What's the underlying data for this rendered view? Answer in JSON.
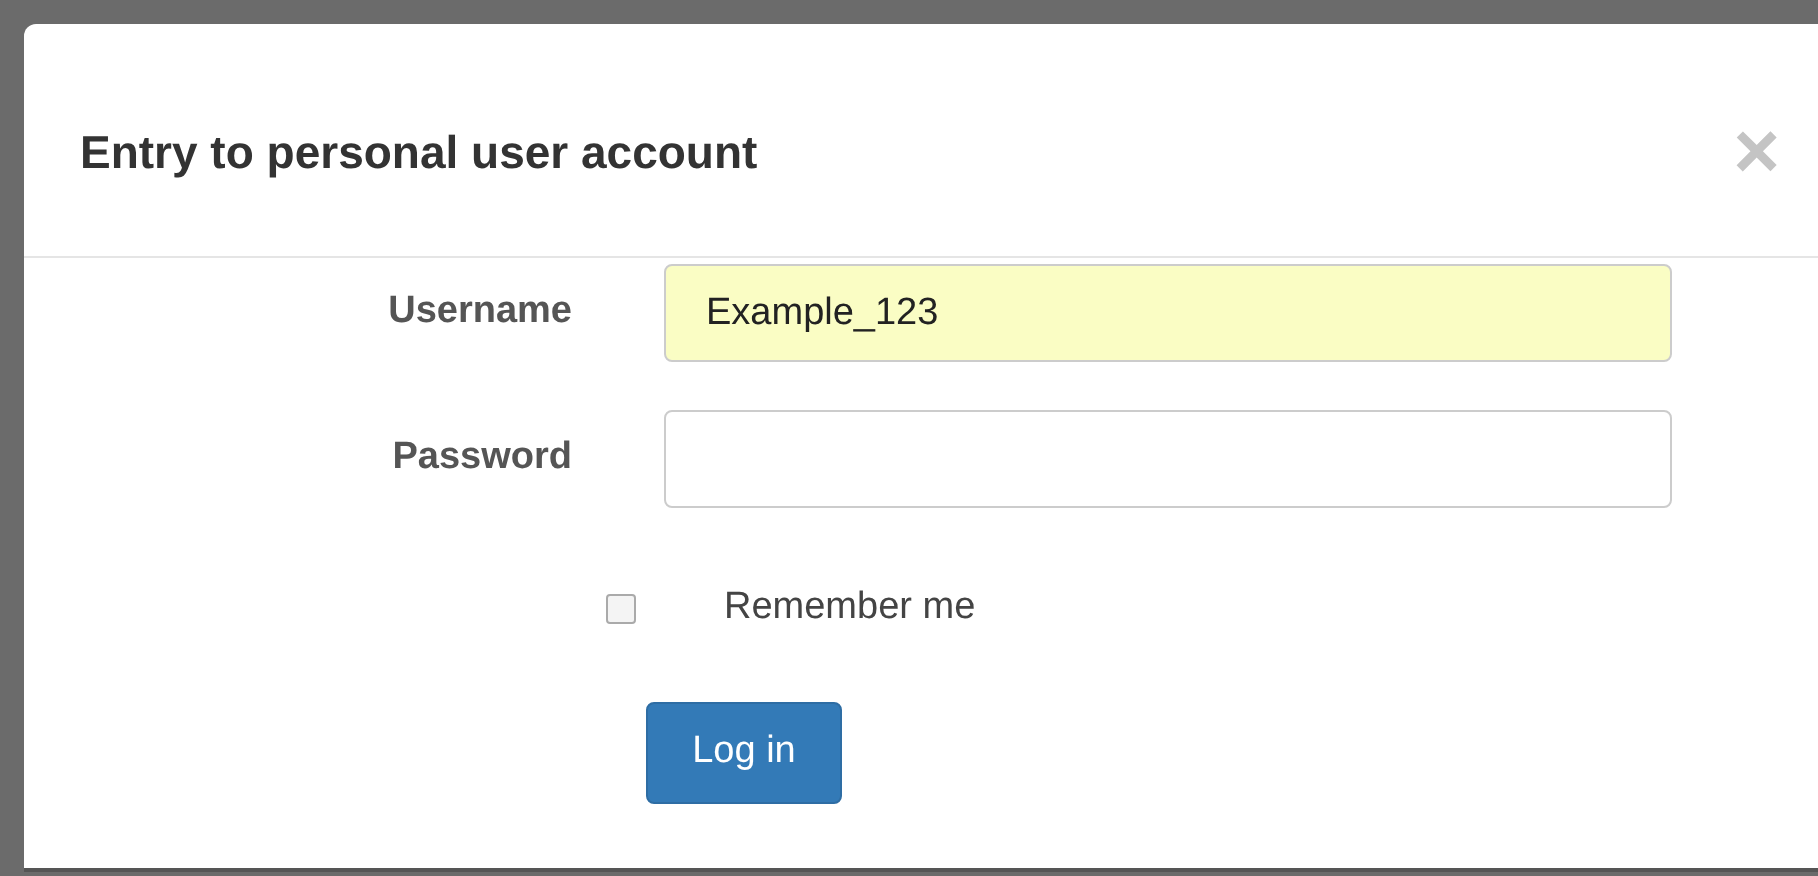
{
  "dialog": {
    "title": "Entry to personal user account",
    "close": "×"
  },
  "fields": [
    {
      "label": "Username",
      "value": "Example_123",
      "autofilled": true
    },
    {
      "label": "Password",
      "autofilled": false
    }
  ],
  "remember": {
    "label": "Remember me",
    "checked": false
  },
  "submit": {
    "label": "Log in"
  }
}
